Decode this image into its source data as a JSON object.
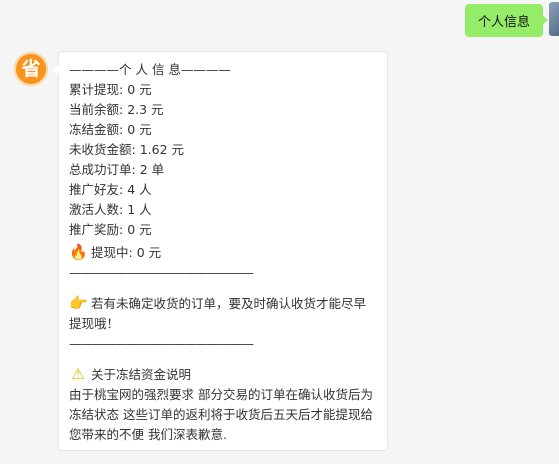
{
  "outgoing": {
    "text": "个人信息"
  },
  "bot": {
    "avatar_text": "省",
    "header": "————个 人 信 息————",
    "stats": [
      {
        "label": "累计提现",
        "value": "0 元"
      },
      {
        "label": "当前余额",
        "value": "2.3 元"
      },
      {
        "label": "冻结金额",
        "value": "0 元"
      },
      {
        "label": "未收货金额",
        "value": "1.62 元"
      },
      {
        "label": "总成功订单",
        "value": "2 单"
      },
      {
        "label": "推广好友",
        "value": "4 人"
      },
      {
        "label": "激活人数",
        "value": "1 人"
      },
      {
        "label": "推广奖励",
        "value": "0 元"
      }
    ],
    "withdrawing": {
      "label": "提现中",
      "value": "0 元",
      "icon": "fire-icon"
    },
    "divider": "————————————————",
    "hint": {
      "icon": "pointing-hand-icon",
      "text": "若有未确定收货的订单，要及时确认收货才能尽早提现哦！"
    },
    "freeze_title": {
      "icon": "warning-icon",
      "text": "关于冻结资金说明"
    },
    "freeze_note": "由于桃宝网的强烈要求 部分交易的订单在确认收货后为冻结状态 这些订单的返利将于收货后五天后才能提现给您带来的不便 我们深表歉意."
  }
}
